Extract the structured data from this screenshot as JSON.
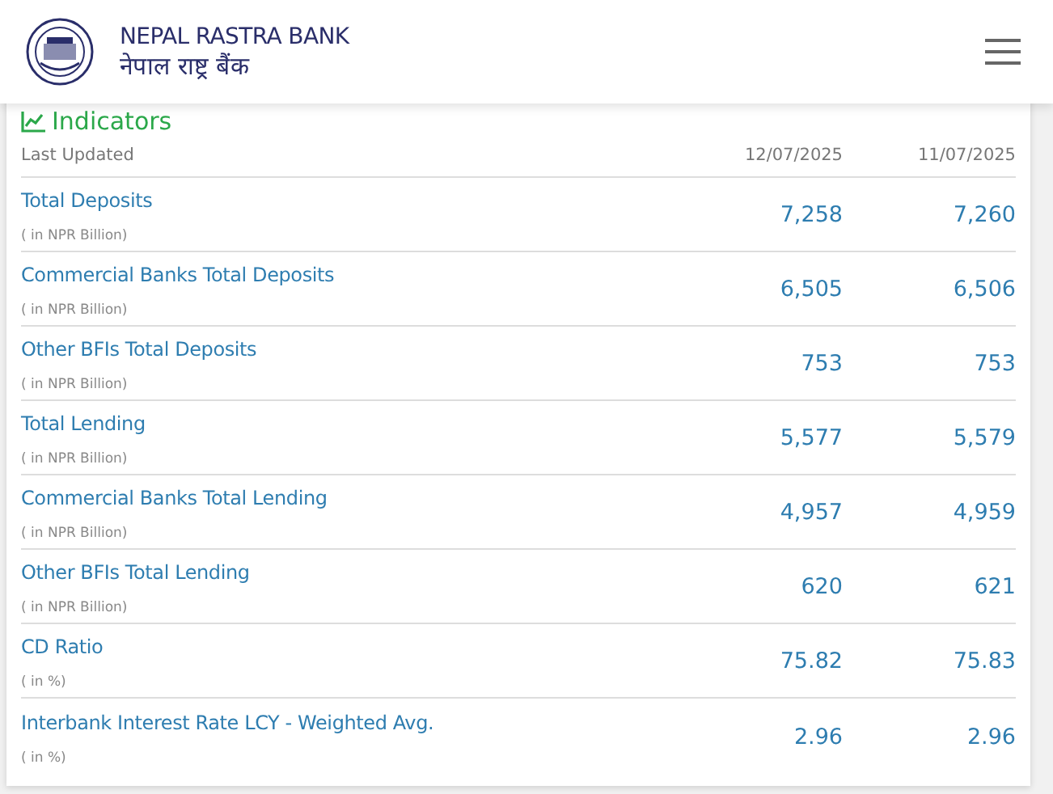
{
  "header": {
    "title": "NEPAL RASTRA BANK",
    "subtitle": "नेपाल राष्ट्र बैंक"
  },
  "indicators": {
    "title": "Indicators",
    "columns": [
      "Last Updated",
      "12/07/2025",
      "11/07/2025"
    ],
    "rows": [
      {
        "label": "Total Deposits",
        "unit": "( in NPR Billion)",
        "values": [
          "7,258",
          "7,260"
        ]
      },
      {
        "label": "Commercial Banks Total Deposits",
        "unit": "( in NPR Billion)",
        "values": [
          "6,505",
          "6,506"
        ]
      },
      {
        "label": "Other BFIs Total Deposits",
        "unit": "( in NPR Billion)",
        "values": [
          "753",
          "753"
        ]
      },
      {
        "label": "Total Lending",
        "unit": "( in NPR Billion)",
        "values": [
          "5,577",
          "5,579"
        ]
      },
      {
        "label": "Commercial Banks Total Lending",
        "unit": "( in NPR Billion)",
        "values": [
          "4,957",
          "4,959"
        ]
      },
      {
        "label": "Other BFIs Total Lending",
        "unit": "( in NPR Billion)",
        "values": [
          "620",
          "621"
        ]
      },
      {
        "label": "CD Ratio",
        "unit": "( in %)",
        "values": [
          "75.82",
          "75.83"
        ]
      },
      {
        "label": "Interbank Interest Rate LCY - Weighted Avg.",
        "unit": "( in %)",
        "values": [
          "2.96",
          "2.96"
        ]
      }
    ]
  }
}
